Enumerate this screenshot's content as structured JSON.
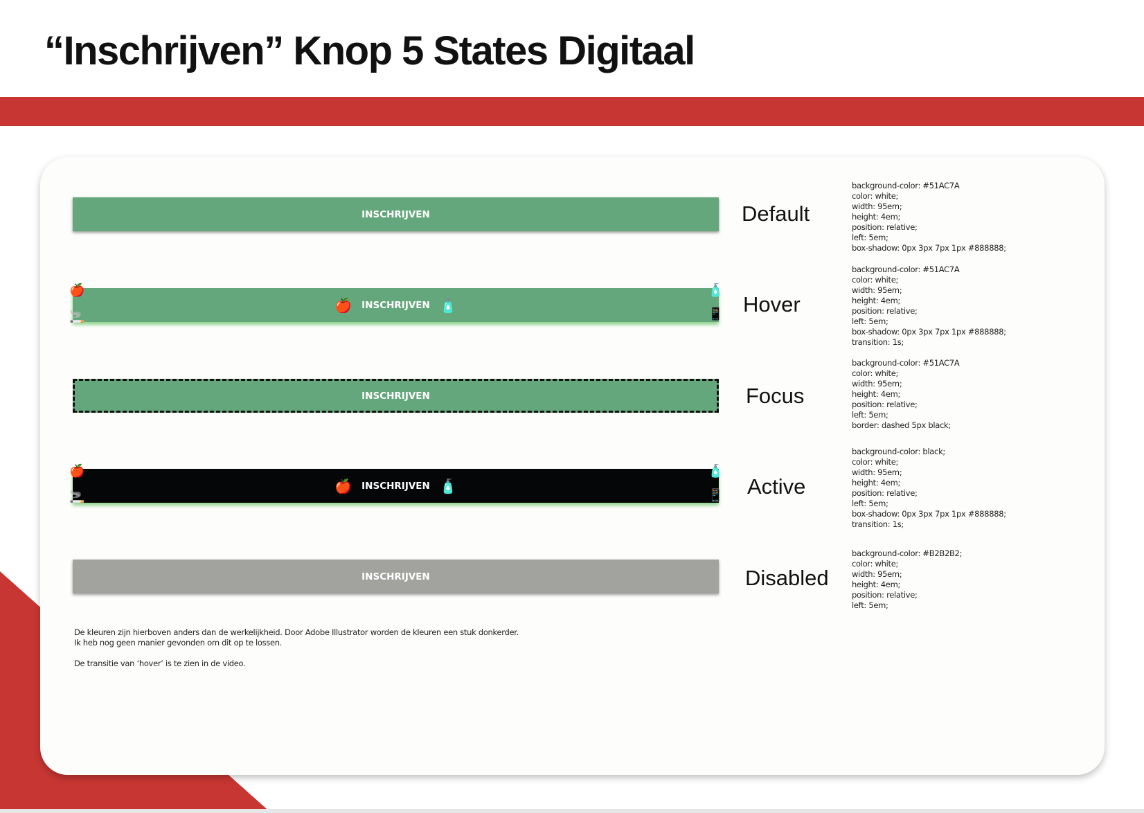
{
  "title": "“Inschrijven” Knop 5 States Digitaal",
  "button_label": "INSCHRIJVEN",
  "colors": {
    "accent": "#c73633",
    "green": "#64a77c",
    "black": "#050608",
    "gray": "#a2a39f"
  },
  "states": [
    {
      "name": "Default",
      "spec": [
        "background-color: #51AC7A",
        "color: white;",
        "width: 95em;",
        "height: 4em;",
        "position: relative;",
        "left: 5em;",
        "box-shadow: 0px 3px 7px 1px #888888;"
      ]
    },
    {
      "name": "Hover",
      "spec": [
        "background-color: #51AC7A",
        "color: white;",
        "width: 95em;",
        "height: 4em;",
        "position: relative;",
        "left: 5em;",
        "box-shadow: 0px 3px 7px 1px #888888;",
        "transition: 1s;"
      ]
    },
    {
      "name": "Focus",
      "spec": [
        "background-color: #51AC7A",
        "color: white;",
        "width: 95em;",
        "height: 4em;",
        "position: relative;",
        "left: 5em;",
        "border: dashed 5px black;"
      ]
    },
    {
      "name": "Active",
      "spec": [
        "background-color: black;",
        "color: white;",
        "width: 95em;",
        "height: 4em;",
        "position: relative;",
        "left: 5em;",
        "box-shadow: 0px 3px 7px 1px #888888;",
        "transition: 1s;"
      ]
    },
    {
      "name": "Disabled",
      "spec": [
        "background-color: #B2B2B2;",
        "color: white;",
        "width: 95em;",
        "height: 4em;",
        "position: relative;",
        "left: 5em;"
      ]
    }
  ],
  "notes": [
    "De kleuren zijn hierboven anders dan de werkelijkheid. Door Adobe Illustrator worden de kleuren een stuk donkerder.",
    "Ik heb nog geen manier gevonden om dit op te lossen.",
    "De transitie van ‘hover’ is te zien in de video."
  ],
  "icons": [
    "apple-core-icon",
    "bottle-icon",
    "cigarette-icon",
    "phone-icon"
  ]
}
